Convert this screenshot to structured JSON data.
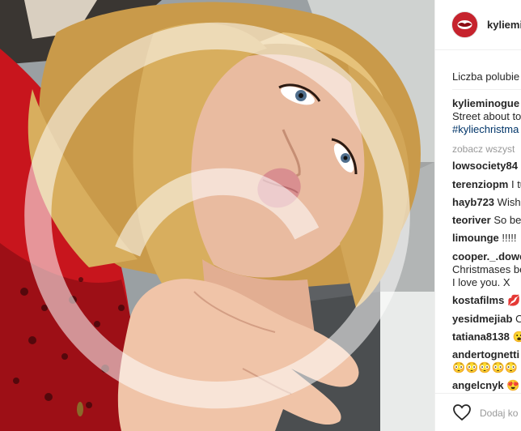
{
  "header": {
    "username": "kyliemi",
    "avatar_icon": "lips-avatar-icon"
  },
  "likes_label": "Liczba polubie",
  "caption": {
    "user": "kylieminogue",
    "line1": "Street about to",
    "line2": "#kyliechristma"
  },
  "view_all": "zobacz wszyst",
  "comments": [
    {
      "user": "lowsociety84",
      "text": "("
    },
    {
      "user": "terenziopm",
      "text": "I tu"
    },
    {
      "user": "hayb723",
      "text": "Wish"
    },
    {
      "user": "teoriver",
      "text": "So be"
    },
    {
      "user": "limounge",
      "text": "!!!!!"
    },
    {
      "user": "cooper._.dowe",
      "text": "Christmases be",
      "text2": "I love you. X"
    },
    {
      "user": "kostafilms",
      "text": "💋"
    },
    {
      "user": "yesidmejiab",
      "text": "O"
    },
    {
      "user": "tatiana8138",
      "text": "😮"
    },
    {
      "user": "andertognetti",
      "text": "😳😳😳😳😳"
    },
    {
      "user": "angelcnyk",
      "text": "😍 😍"
    }
  ],
  "footer": {
    "heart_icon": "heart-icon",
    "add_comment": "Dodaj ko"
  },
  "colors": {
    "border": "#efefef",
    "text": "#262626",
    "muted": "#999999",
    "avatar_red": "#c6232d"
  }
}
